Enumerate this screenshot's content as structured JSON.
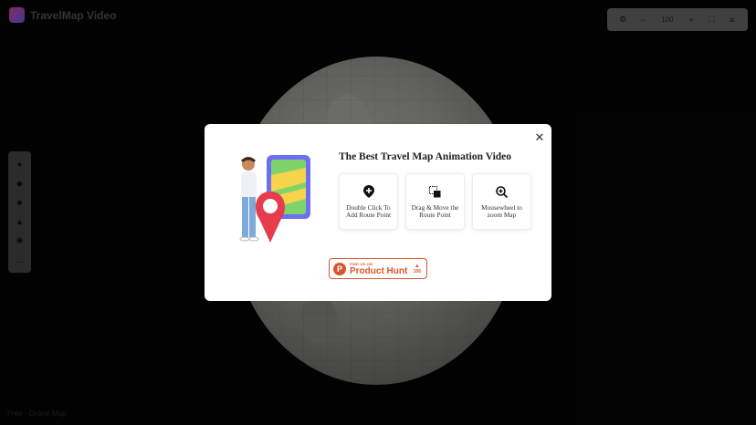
{
  "app": {
    "name": "TravelMap Video",
    "bottom_label": "Free · Online Map"
  },
  "toolbar": {
    "zoom": "100"
  },
  "modal": {
    "title": "The Best Travel Map Animation Video",
    "cards": [
      {
        "icon": "map-pin-plus-icon",
        "label": "Double Click To Add Route Point"
      },
      {
        "icon": "drag-move-icon",
        "label": "Drag & Move the Route Point"
      },
      {
        "icon": "zoom-in-icon",
        "label": "Mousewheel to zoom Map"
      }
    ],
    "product_hunt": {
      "small": "FIND US ON",
      "name": "Product Hunt",
      "logo": "P",
      "votes": "106"
    }
  },
  "colors": {
    "brand_gradient_start": "#e14fae",
    "brand_gradient_end": "#7a5cf2",
    "product_hunt": "#da552f",
    "modal_bg": "#ffffff"
  }
}
